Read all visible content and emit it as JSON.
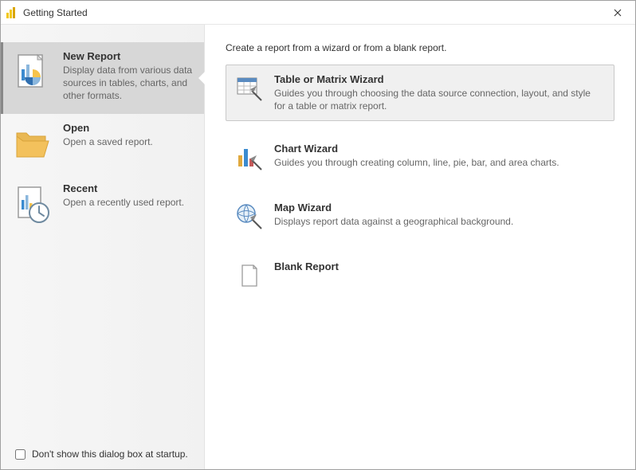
{
  "window": {
    "title": "Getting Started"
  },
  "sidebar": {
    "items": [
      {
        "title": "New Report",
        "desc": "Display data from various data sources in tables, charts, and other formats."
      },
      {
        "title": "Open",
        "desc": "Open a saved report."
      },
      {
        "title": "Recent",
        "desc": "Open a recently used report."
      }
    ],
    "checkbox_label": "Don't show this dialog box at startup."
  },
  "main": {
    "heading": "Create a report from a wizard or from a blank report.",
    "options": [
      {
        "title": "Table or Matrix Wizard",
        "desc": "Guides you through choosing the data source connection, layout, and style for a table or matrix report."
      },
      {
        "title": "Chart Wizard",
        "desc": "Guides you through creating column, line, pie, bar, and area charts."
      },
      {
        "title": "Map Wizard",
        "desc": "Displays report data against a geographical background."
      },
      {
        "title": "Blank Report",
        "desc": ""
      }
    ]
  }
}
